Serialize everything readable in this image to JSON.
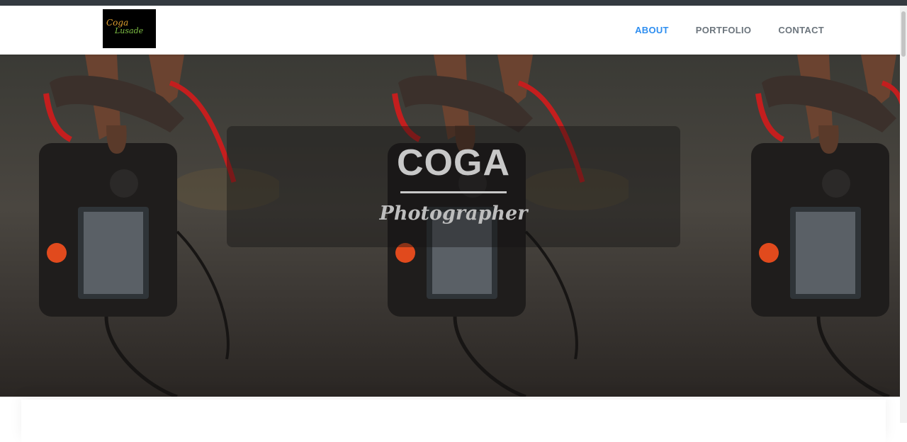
{
  "logo": {
    "line1": "Coga",
    "line2": "Lusade"
  },
  "nav": {
    "items": [
      {
        "label": "ABOUT"
      },
      {
        "label": "PORTFOLIO"
      },
      {
        "label": "CONTACT"
      }
    ],
    "active_color": "#2e8ef0",
    "inactive_color": "#6c757d"
  },
  "hero": {
    "title": "COGA",
    "subtitle": "Photographer",
    "background_image": "photo of a hand holding a camera by its red strap, repeated three times"
  }
}
